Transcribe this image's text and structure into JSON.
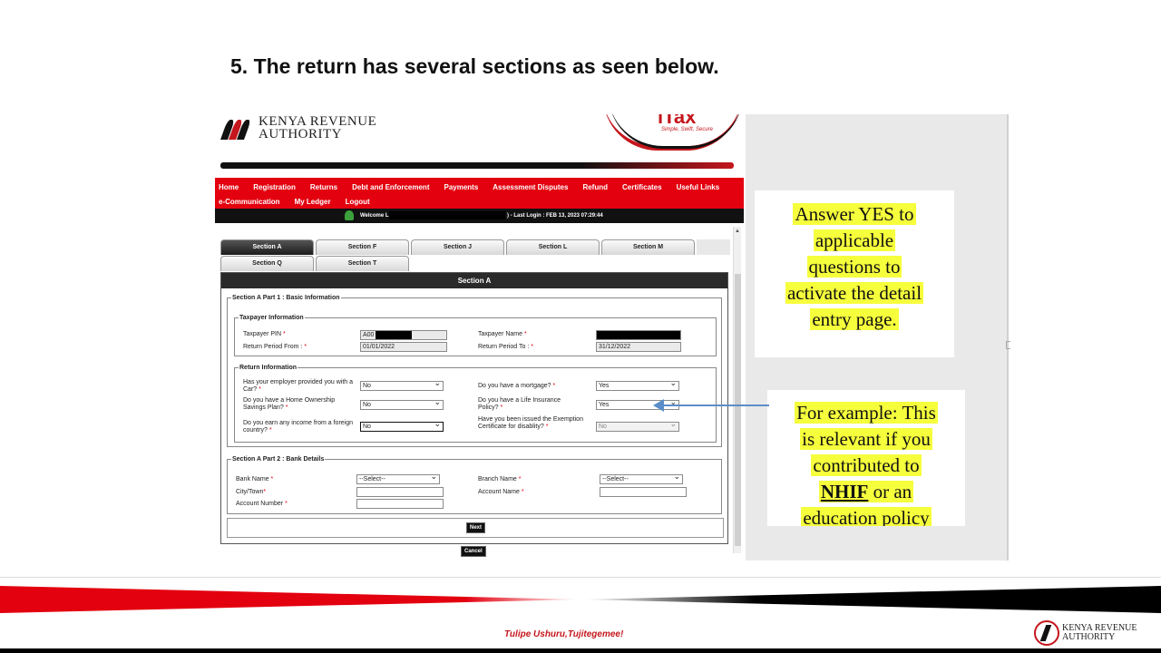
{
  "slide": {
    "title": "5. The return has several sections as seen below."
  },
  "header": {
    "kra_line1": "KENYA REVENUE",
    "kra_line2": "AUTHORITY",
    "itax_word": "iTax",
    "itax_slogan": "Simple, Swift, Secure"
  },
  "nav": {
    "row1": [
      "Home",
      "Registration",
      "Returns",
      "Debt and Enforcement",
      "Payments",
      "Assessment Disputes",
      "Refund",
      "Certificates",
      "Useful Links"
    ],
    "row2": [
      "e-Communication",
      "My Ledger",
      "Logout"
    ]
  },
  "welcome": {
    "prefix": "Welcome L",
    "last_login": ") - Last Login : FEB 13, 2023 07:29:44"
  },
  "tabs": {
    "row1": [
      "Section A",
      "Section F",
      "Section J",
      "Section L",
      "Section M"
    ],
    "row2": [
      "Section Q",
      "Section T"
    ],
    "active": "Section A"
  },
  "form": {
    "section_title": "Section A",
    "part1_legend": "Section A Part 1 : Basic Information",
    "taxpayer_legend": "Taxpayer Information",
    "pin_label": "Taxpayer PIN",
    "pin_value": "A00",
    "name_label": "Taxpayer Name",
    "period_from_label": "Return Period From :",
    "period_from_value": "01/01/2022",
    "period_to_label": "Return Period To :",
    "period_to_value": "31/12/2022",
    "return_legend": "Return Information",
    "q_car": "Has your employer provided you with a Car?",
    "q_car_value": "No",
    "q_mortgage": "Do you have a mortgage?",
    "q_mortgage_value": "Yes",
    "q_hosp": "Do you have a Home Ownership Savings Plan?",
    "q_hosp_value": "No",
    "q_life": "Do you have a Life Insurance Policy?",
    "q_life_value": "Yes",
    "q_foreign": "Do you earn any income from a foreign country?",
    "q_foreign_value": "No",
    "q_disability": "Have you been issued the Exemption Certificate for disablity?",
    "q_disability_value": "No",
    "part2_legend": "Section A Part 2 : Bank Details",
    "bank_label": "Bank Name",
    "bank_value": "--Select--",
    "branch_label": "Branch Name",
    "branch_value": "--Select--",
    "city_label": "City/Town",
    "account_name_label": "Account Name",
    "account_number_label": "Account Number",
    "next_label": "Next",
    "cancel_label": "Cancel",
    "required_mark": "*"
  },
  "callouts": {
    "c1_lines": [
      "Answer YES to",
      "applicable",
      "questions to",
      "activate the detail",
      "entry page."
    ],
    "c2_line1": "For example: This",
    "c2_line2": "is relevant if you",
    "c2_line3": "contributed to",
    "c2_nhif": "NHIF",
    "c2_line4_rest": " or an",
    "c2_line5": "education policy"
  },
  "footer": {
    "tagline": "Tulipe Ushuru,Tujitegemee!",
    "kra_line1": "KENYA REVENUE",
    "kra_line2": "AUTHORITY"
  },
  "colors": {
    "kra_red": "#e3000f",
    "highlight": "#f6ff3c",
    "arrow": "#5b8ec9"
  }
}
